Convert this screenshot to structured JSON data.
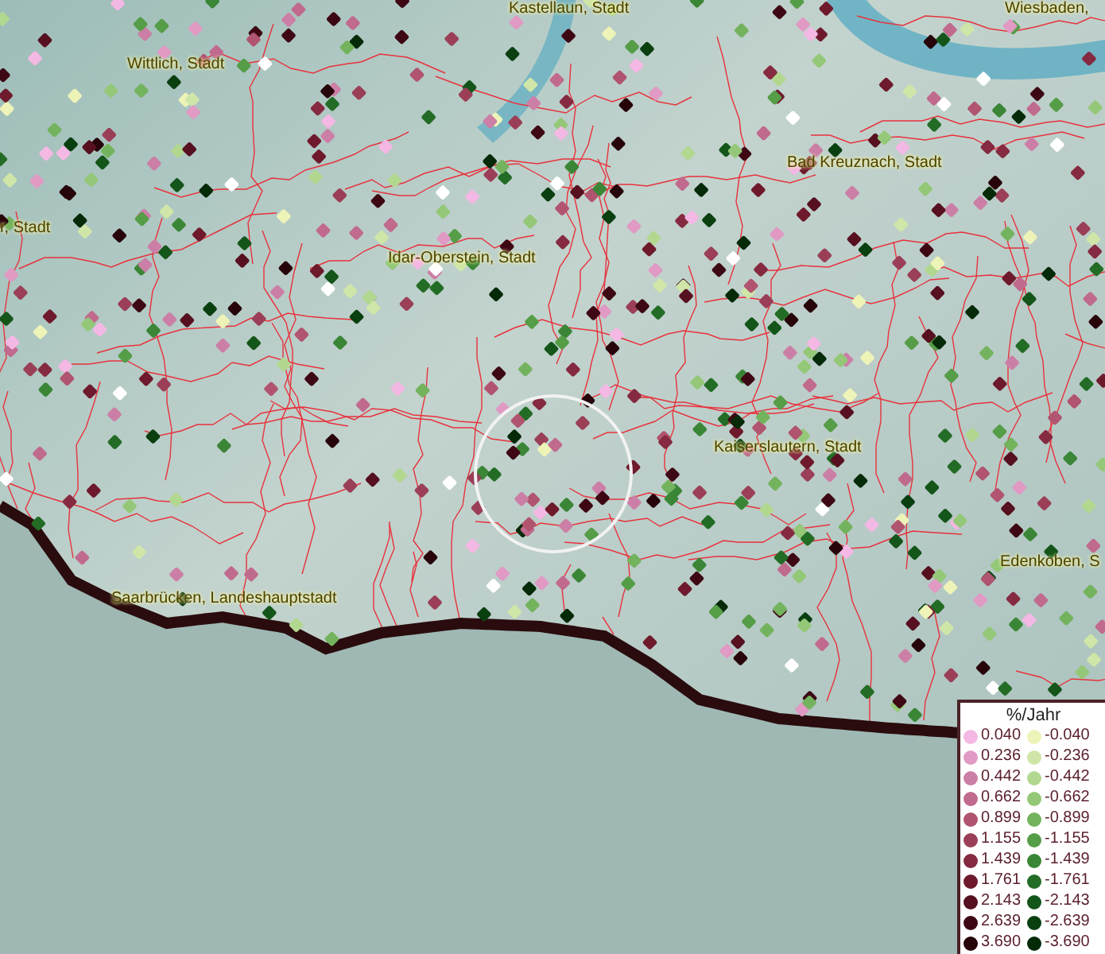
{
  "map": {
    "places": [
      {
        "name": "Kastellaun, Stadt"
      },
      {
        "name": "Wiesbaden,"
      },
      {
        "name": "Wittlich, Stadt"
      },
      {
        "name": "Bad Kreuznach, Stadt"
      },
      {
        "name": "r, Stadt"
      },
      {
        "name": "Idar-Oberstein, Stadt"
      },
      {
        "name": "Kaiserslautern, Stadt"
      },
      {
        "name": "Edenkoben, S"
      },
      {
        "name": "Saarbrücken, Landeshauptstadt"
      }
    ]
  },
  "legend": {
    "title": "%/Jahr",
    "positive": [
      {
        "label": "0.040",
        "color": "#f4b8e4"
      },
      {
        "label": "0.236",
        "color": "#e09ac4"
      },
      {
        "label": "0.442",
        "color": "#cc7fa6"
      },
      {
        "label": "0.662",
        "color": "#c06a8e"
      },
      {
        "label": "0.899",
        "color": "#b0546f"
      },
      {
        "label": "1.155",
        "color": "#9a3f57"
      },
      {
        "label": "1.439",
        "color": "#852a40"
      },
      {
        "label": "1.761",
        "color": "#6e1a2c"
      },
      {
        "label": "2.143",
        "color": "#561020"
      },
      {
        "label": "2.639",
        "color": "#3d0814"
      },
      {
        "label": "3.690",
        "color": "#26040a"
      }
    ],
    "negative": [
      {
        "label": "-0.040",
        "color": "#eef3b8"
      },
      {
        "label": "-0.236",
        "color": "#cfe6a8"
      },
      {
        "label": "-0.442",
        "color": "#b2d890"
      },
      {
        "label": "-0.662",
        "color": "#94c878"
      },
      {
        "label": "-0.899",
        "color": "#74b35e"
      },
      {
        "label": "-1.155",
        "color": "#559d47"
      },
      {
        "label": "-1.439",
        "color": "#3a8636"
      },
      {
        "label": "-1.761",
        "color": "#236c25"
      },
      {
        "label": "-2.143",
        "color": "#14551a"
      },
      {
        "label": "-2.639",
        "color": "#0a3f10"
      },
      {
        "label": "-3.690",
        "color": "#042a08"
      }
    ]
  }
}
